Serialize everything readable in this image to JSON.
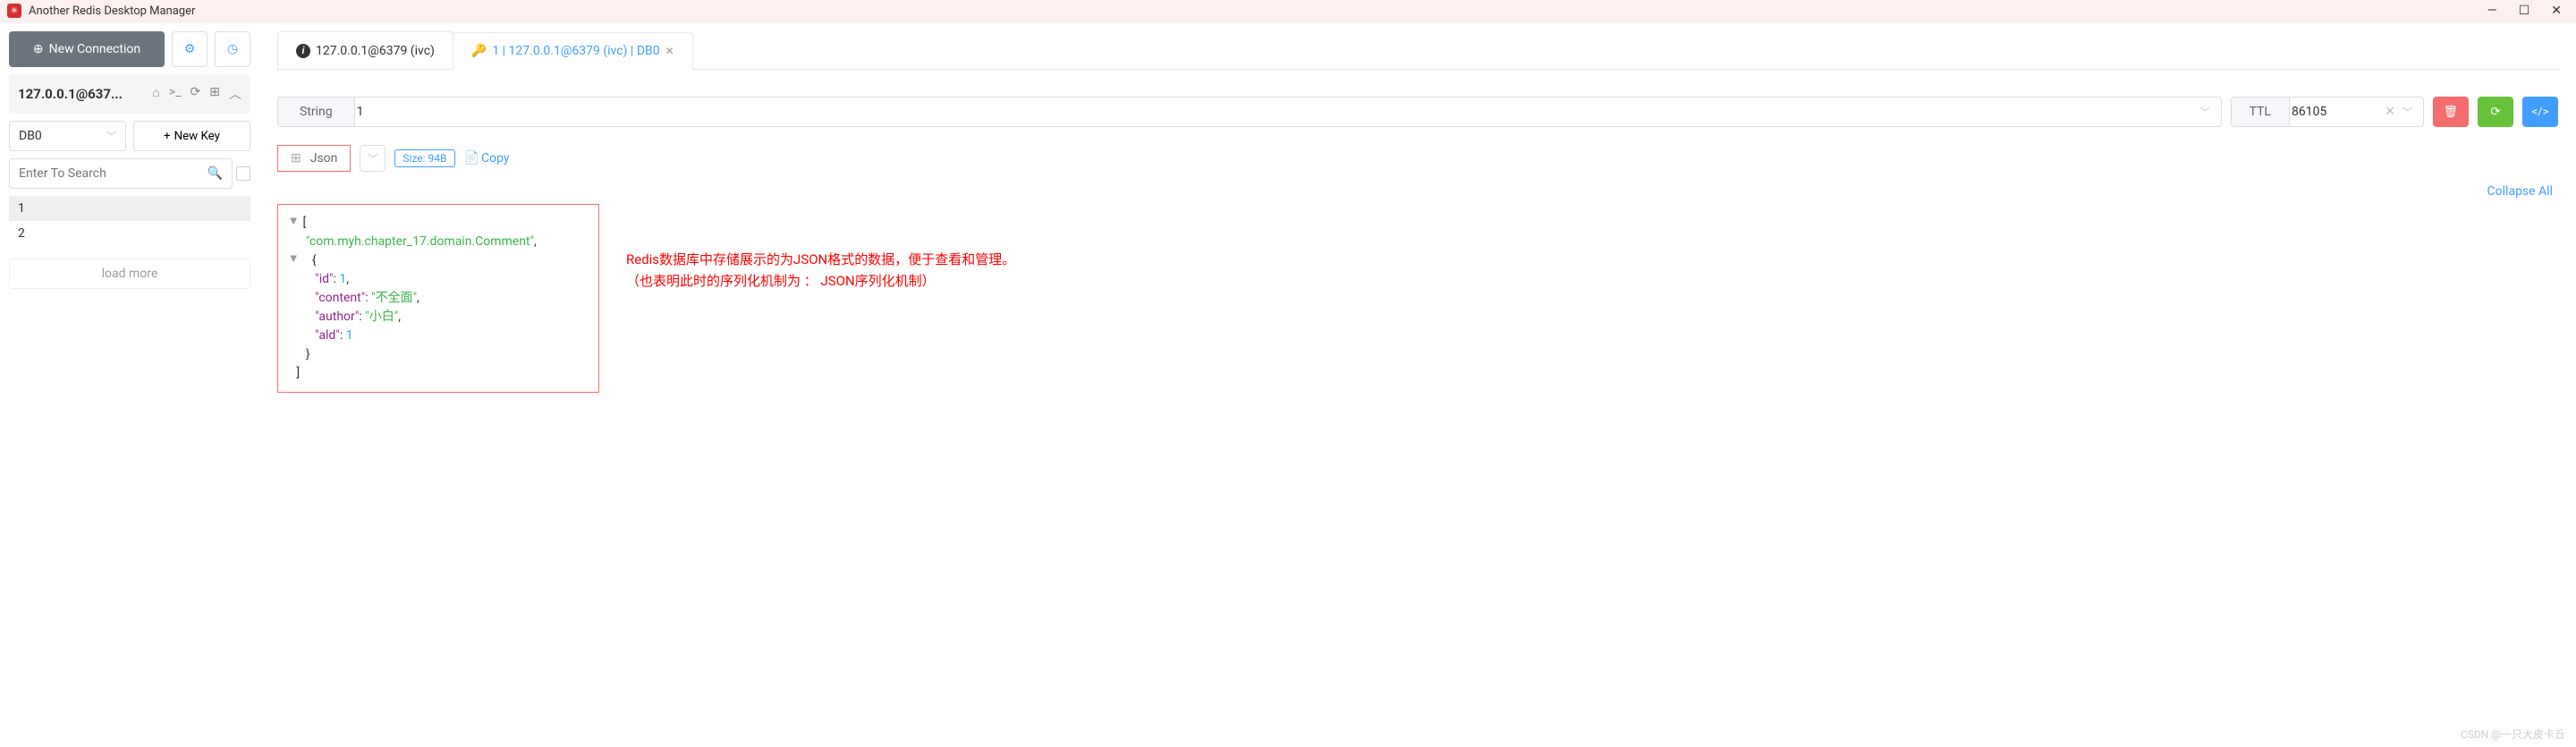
{
  "window": {
    "title": "Another Redis Desktop Manager"
  },
  "sidebar": {
    "new_connection": "New Connection",
    "connection_label": "127.0.0.1@637...",
    "db_selected": "DB0",
    "new_key": "New Key",
    "search_placeholder": "Enter To Search",
    "keys": [
      "1",
      "2"
    ],
    "load_more": "load more"
  },
  "tabs": [
    {
      "label": "127.0.0.1@6379 (ivc)",
      "active": false
    },
    {
      "label": "1 | 127.0.0.1@6379 (ivc) | DB0",
      "active": true
    }
  ],
  "key_detail": {
    "type": "String",
    "key_name": "1",
    "ttl_label": "TTL",
    "ttl_value": "86105"
  },
  "format_row": {
    "format": "Json",
    "size": "Size: 94B",
    "copy": "Copy"
  },
  "collapse_all": "Collapse All",
  "json_content": {
    "class_name": "com.myh.chapter_17.domain.Comment",
    "fields": {
      "id": 1,
      "content": "不全面",
      "author": "小白",
      "ald": 1
    }
  },
  "annotation": {
    "line1": "Redis数据库中存储展示的为JSON格式的数据，便于查看和管理。",
    "line2": "（也表明此时的序列化机制为 ： JSON序列化机制）"
  },
  "watermark": "CSDN @一只大皮卡丘"
}
